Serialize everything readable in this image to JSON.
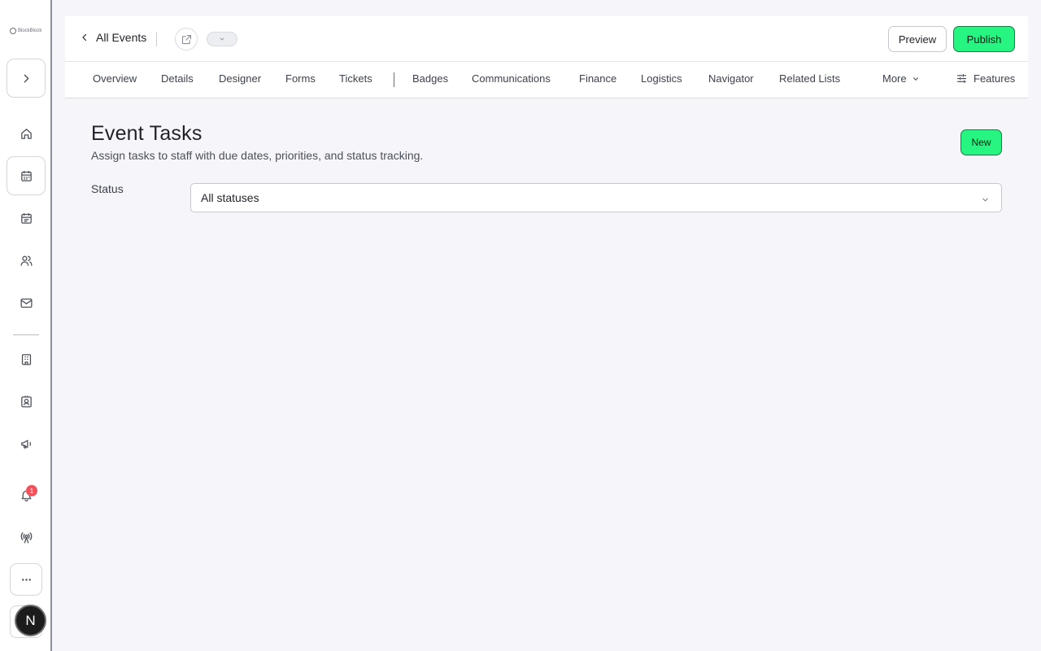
{
  "sidebar": {
    "logo_text": "BlockBlock",
    "items": [
      {
        "name": "expand",
        "icon": "chevron-right-icon"
      },
      {
        "name": "home",
        "icon": "home-icon"
      },
      {
        "name": "events",
        "icon": "calendar-icon"
      },
      {
        "name": "schedule",
        "icon": "calendar-list-icon"
      },
      {
        "name": "people",
        "icon": "users-icon"
      },
      {
        "name": "mail",
        "icon": "mail-icon"
      },
      {
        "name": "venues",
        "icon": "building-icon"
      },
      {
        "name": "contacts",
        "icon": "contact-card-icon"
      },
      {
        "name": "marketing",
        "icon": "megaphone-icon"
      },
      {
        "name": "notifications",
        "icon": "bell-icon"
      },
      {
        "name": "broadcast",
        "icon": "broadcast-icon"
      },
      {
        "name": "more",
        "icon": "ellipsis-icon"
      }
    ],
    "notification_count": "1",
    "avatar_initial": "N"
  },
  "header": {
    "back_label": "All Events",
    "preview_label": "Preview",
    "publish_label": "Publish"
  },
  "tabs": [
    "Overview",
    "Details",
    "Designer",
    "Forms",
    "Tickets",
    "Badges",
    "Communications",
    "Finance",
    "Logistics",
    "Navigator",
    "Related Lists"
  ],
  "tabs_more_label": "More",
  "features_label": "Features",
  "main": {
    "title": "Event Tasks",
    "subtitle": "Assign tasks to staff with due dates, priorities, and status tracking.",
    "new_label": "New",
    "status_label": "Status",
    "status_value": "All statuses"
  },
  "colors": {
    "accent": "#27f582",
    "badge": "#f2525b",
    "background": "#f5f5fa"
  }
}
